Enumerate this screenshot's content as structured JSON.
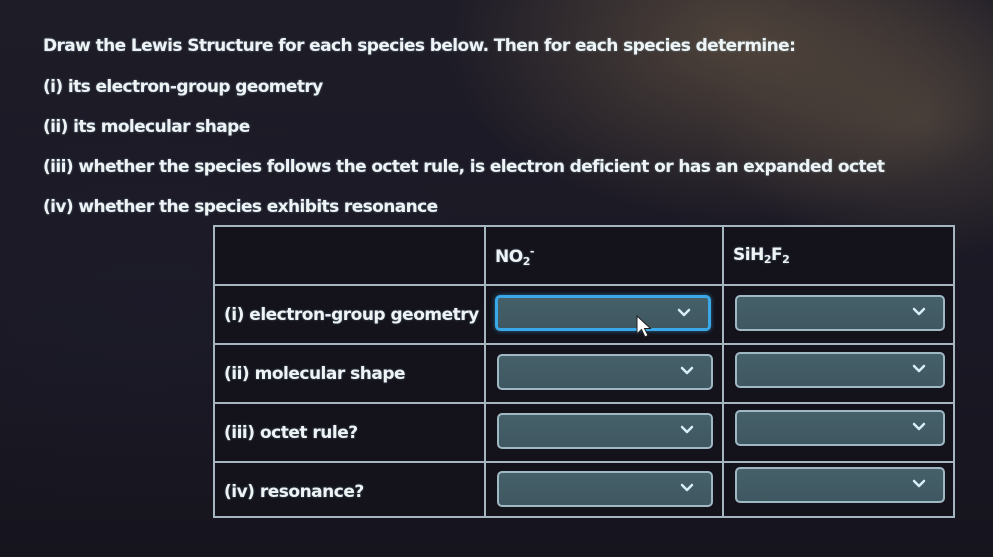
{
  "instructions": {
    "lines": [
      "Draw the Lewis Structure for each species below. Then for each species determine:",
      "(i) its electron-group geometry",
      "(ii) its molecular shape",
      "(iii) whether the species follows the octet rule, is electron deficient or has an expanded octet",
      "(iv) whether the species exhibits resonance"
    ]
  },
  "table": {
    "columns": [
      {
        "formula_parts": [
          "NO",
          "2",
          "-"
        ],
        "label": "NO2-"
      },
      {
        "formula_parts": [
          "SiH",
          "2",
          "F",
          "2"
        ],
        "label": "SiH2F2"
      }
    ],
    "rows": [
      {
        "label": "(i) electron-group geometry",
        "values": [
          "",
          ""
        ]
      },
      {
        "label": "(ii) molecular shape",
        "values": [
          "",
          ""
        ]
      },
      {
        "label": "(iii) octet rule?",
        "values": [
          "",
          ""
        ]
      },
      {
        "label": "(iv) resonance?",
        "values": [
          "",
          ""
        ]
      }
    ],
    "focused_cell": {
      "row": 0,
      "col": 0
    }
  },
  "icons": {
    "dropdown_chevron": "chevron-down-icon",
    "pointer": "mouse-pointer-icon"
  },
  "colors": {
    "background": "#1a1824",
    "table_border": "#a6b6c0",
    "dropdown_fill": "#466069",
    "dropdown_border": "#9fb8c4",
    "focus_border": "#3aa7e6",
    "text": "#eef4f6"
  }
}
